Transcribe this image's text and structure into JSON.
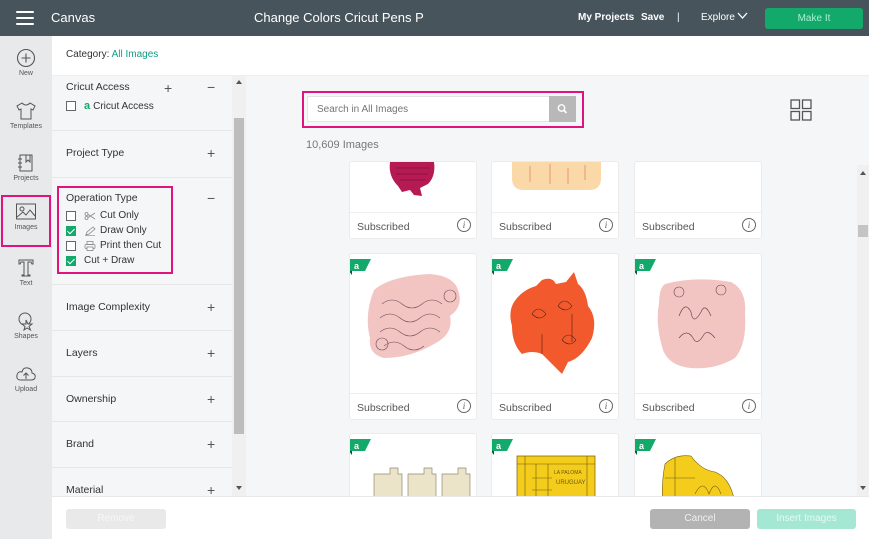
{
  "topbar": {
    "app_name": "Canvas",
    "doc_title": "Change Colors Cricut Pens P",
    "my_projects": "My Projects",
    "save": "Save",
    "separator": "|",
    "explore": "Explore",
    "make_it": "Make It"
  },
  "rail": {
    "items": [
      {
        "label": "New",
        "icon": "plus-circle-icon"
      },
      {
        "label": "Templates",
        "icon": "tshirt-icon"
      },
      {
        "label": "Projects",
        "icon": "notebook-icon"
      },
      {
        "label": "Images",
        "icon": "image-icon",
        "active": true
      },
      {
        "label": "Text",
        "icon": "text-t-icon"
      },
      {
        "label": "Shapes",
        "icon": "shapes-icon"
      },
      {
        "label": "Upload",
        "icon": "cloud-upload-icon"
      }
    ]
  },
  "category": {
    "label": "Category: ",
    "value": "All Images"
  },
  "filters": {
    "cricut_access": {
      "title": "Cricut Access",
      "options": [
        {
          "label": "Cricut Access",
          "checked": false
        }
      ]
    },
    "project_type": {
      "title": "Project Type"
    },
    "operation_type": {
      "title": "Operation Type",
      "options": [
        {
          "label": "Cut Only",
          "checked": false,
          "icon": "scissors-icon"
        },
        {
          "label": "Draw Only",
          "checked": true,
          "icon": "pen-icon"
        },
        {
          "label": "Print then Cut",
          "checked": false,
          "icon": "printer-icon"
        },
        {
          "label": "Cut + Draw",
          "checked": true
        }
      ]
    },
    "image_complexity": {
      "title": "Image Complexity"
    },
    "layers": {
      "title": "Layers"
    },
    "ownership": {
      "title": "Ownership"
    },
    "brand": {
      "title": "Brand"
    },
    "material": {
      "title": "Material"
    }
  },
  "search": {
    "placeholder": "Search in All Images",
    "value": ""
  },
  "results": {
    "count": "10,609 Images",
    "cards": [
      {
        "status": "Subscribed",
        "art": "red-bow",
        "access_badge": false
      },
      {
        "status": "Subscribed",
        "art": "peach-shape",
        "access_badge": false
      },
      {
        "status": "Subscribed",
        "art": "blank",
        "access_badge": false
      },
      {
        "status": "Subscribed",
        "art": "poppy-verse-sticker",
        "access_badge": true
      },
      {
        "status": "Subscribed",
        "art": "australia-poppies",
        "access_badge": true
      },
      {
        "status": "Subscribed",
        "art": "lest-we-forget",
        "access_badge": true
      },
      {
        "status": "",
        "art": "lanterns",
        "access_badge": true
      },
      {
        "status": "",
        "art": "la-paloma-uruguay",
        "access_badge": true
      },
      {
        "status": "",
        "art": "yellow-map",
        "access_badge": true
      }
    ],
    "info_glyph": "i"
  },
  "footer": {
    "remove": "Remove",
    "cancel": "Cancel",
    "insert": "Insert Images"
  },
  "colors": {
    "topbar": "#47545c",
    "accent_green": "#13a96b",
    "highlight_pink": "#e0137f",
    "category_teal": "#0f9e86"
  }
}
